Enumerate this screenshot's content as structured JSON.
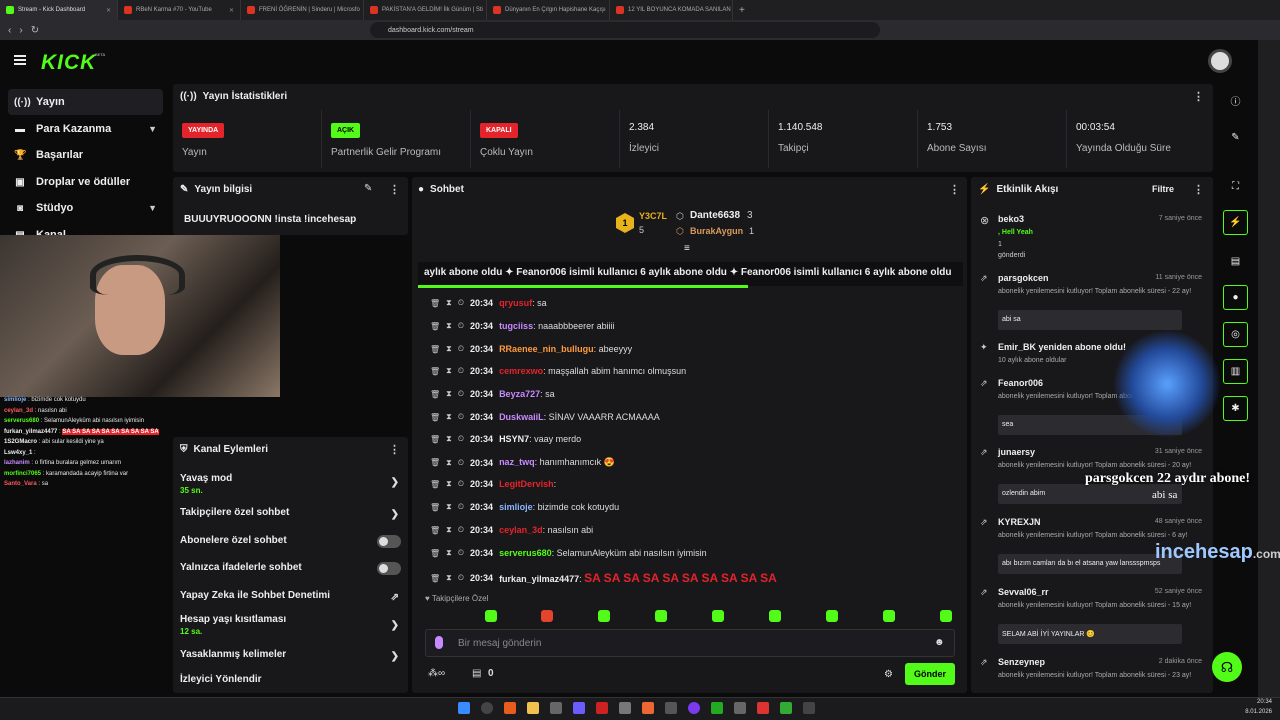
{
  "browser": {
    "tabs": [
      {
        "title": "Stream - Kick Dashboard",
        "active": true
      },
      {
        "title": "RBeN Karma #70 - YouTube"
      },
      {
        "title": "FRENİ ÖĞRENİN | Sinderu | Microsfo"
      },
      {
        "title": "PAKİSTAN'A GELDİM! İlk Günüm | Sti"
      },
      {
        "title": "Dünyanın En Çılgın Hapishane Kaçışı"
      },
      {
        "title": "12 YIL BOYUNCA KOMADA SANILAN"
      }
    ],
    "url": "dashboard.kick.com/stream"
  },
  "brand": {
    "logo": "KICK",
    "beta": "BETA"
  },
  "sidebar": {
    "items": [
      {
        "label": "Yayın",
        "icon": "broadcast-icon"
      },
      {
        "label": "Para Kazanma",
        "icon": "money-icon"
      },
      {
        "label": "Başarılar",
        "icon": "trophy-icon"
      },
      {
        "label": "Droplar ve ödüller",
        "icon": "gift-icon"
      },
      {
        "label": "Stüdyo",
        "icon": "studio-icon"
      },
      {
        "label": "Kanal",
        "icon": "channel-icon"
      }
    ]
  },
  "stats": {
    "title": "Yayın İstatistikleri",
    "items": [
      {
        "badge": "YAYINDA",
        "label": "Yayın",
        "color": "#e3242b"
      },
      {
        "badge": "AÇIK",
        "label": "Partnerlik Gelir Programı",
        "color": "#53fc18"
      },
      {
        "badge": "KAPALI",
        "label": "Çoklu Yayın",
        "color": "#e3242b"
      },
      {
        "value": "2.384",
        "label": "İzleyici"
      },
      {
        "value": "1.140.548",
        "label": "Takipçi"
      },
      {
        "value": "1.753",
        "label": "Abone Sayısı"
      },
      {
        "value": "00:03:54",
        "label": "Yayında Olduğu Süre"
      }
    ]
  },
  "info": {
    "title": "Yayın bilgisi",
    "stream_title": "BUUUYRUOOONN !insta !incehesap"
  },
  "overlay_chat": [
    {
      "user": "simlioje",
      "msg": "bizimde cok kotuydu",
      "color": "#8ab4ff"
    },
    {
      "user": "ceylan_3d",
      "msg": "nasılsn abi",
      "color": "#ff5a5a"
    },
    {
      "user": "serverus680",
      "msg": "SelamunAleyküm abi nasılsın iyimisin",
      "color": "#53fc18"
    },
    {
      "user": "furkan_yilmaz4477",
      "msg": "SA SA SA SA SA SA SA SA SA SA",
      "color": "#eee"
    },
    {
      "user": "1S2GMacro",
      "msg": "abi sular kesildi yine ya",
      "color": "#eee"
    },
    {
      "user": "Lsw4xy_1",
      "msg": "",
      "color": "#eee"
    },
    {
      "user": "lazhanim",
      "msg": "o firtina buralara gelmez umarım",
      "color": "#c78bff"
    },
    {
      "user": "morfinci7065",
      "msg": "karamandada acayip firtina var",
      "color": "#53fc18"
    },
    {
      "user": "Santo_Vara",
      "msg": "sa",
      "color": "#ff5a5a"
    }
  ],
  "actions": {
    "title": "Kanal Eylemleri",
    "items": [
      {
        "label": "Yavaş mod",
        "sub": "35 sn.",
        "type": "chevron"
      },
      {
        "label": "Takipçilere özel sohbet",
        "type": "chevron"
      },
      {
        "label": "Abonelere özel sohbet",
        "type": "toggle"
      },
      {
        "label": "Yalnızca ifadelerle sohbet",
        "type": "toggle"
      },
      {
        "label": "Yapay Zeka ile Sohbet Denetimi",
        "type": "external"
      },
      {
        "label": "Hesap yaşı kısıtlaması",
        "sub": "12 sa.",
        "type": "chevron"
      },
      {
        "label": "Yasaklanmış kelimeler",
        "type": "chevron"
      },
      {
        "label": "İzleyici Yönlendir",
        "type": "none"
      }
    ]
  },
  "chat": {
    "title": "Sohbet",
    "leaders": [
      {
        "rank": "1",
        "name": "Y3C7L",
        "count": "5"
      },
      {
        "name": "Dante6638",
        "count": "3"
      },
      {
        "name": "BurakAygun",
        "count": "1"
      }
    ],
    "ticker": "aylık abone oldu  ✦ Feanor006 isimli kullanıcı 6 aylık abone oldu  ✦ Feanor006 isimli kullanıcı 6 aylık abone oldu",
    "messages": [
      {
        "time": "20:34",
        "user": "qryusuf",
        "msg": "sa",
        "color": "#e3242b"
      },
      {
        "time": "20:34",
        "user": "tugciiss",
        "msg": "naaabbbeerer abiiii",
        "color": "#c78bff"
      },
      {
        "time": "20:34",
        "user": "RRaenee_nin_bullugu",
        "msg": "abeeyyy",
        "color": "#ff9a3c"
      },
      {
        "time": "20:34",
        "user": "cemrexwo",
        "msg": "maşşallah abim hanımcı olmuşsun",
        "color": "#e3242b"
      },
      {
        "time": "20:34",
        "user": "Beyza727",
        "msg": "sa",
        "color": "#c78bff"
      },
      {
        "time": "20:34",
        "user": "DuskwaiiL",
        "msg": "SİNAV VAAARR ACMAAAA",
        "color": "#c78bff"
      },
      {
        "time": "20:34",
        "user": "HSYN7",
        "msg": "vaay merdo",
        "color": "#eee"
      },
      {
        "time": "20:34",
        "user": "naz_twq",
        "msg": "hanımhanımcık 😍",
        "color": "#c78bff"
      },
      {
        "time": "20:34",
        "user": "LegitDervish",
        "msg": "",
        "color": "#e3242b"
      },
      {
        "time": "20:34",
        "user": "simlioje",
        "msg": "bizimde cok kotuydu",
        "color": "#8ab4ff"
      },
      {
        "time": "20:34",
        "user": "ceylan_3d",
        "msg": "nasılsın abi",
        "color": "#e3242b"
      },
      {
        "time": "20:34",
        "user": "serverus680",
        "msg": "SelamunAleyküm abi nasılsın iyimisin",
        "color": "#53fc18"
      },
      {
        "time": "20:34",
        "user": "furkan_yilmaz4477",
        "msg": "SA SA SA SA SA SA SA SA SA SA",
        "color": "#eee"
      }
    ],
    "mode": "Takipçilere Özel",
    "placeholder": "Bir mesaj gönderin",
    "points": "0",
    "send": "Gönder"
  },
  "activity": {
    "title": "Etkinlik Akışı",
    "filter": "Filtre",
    "items": [
      {
        "name": "beko3",
        "time": "7 saniye önce",
        "desc": ", Hell Yeah",
        "extra": "1",
        "extra2": "gönderdi"
      },
      {
        "name": "parsgokcen",
        "time": "11 saniye önce",
        "desc": "abonelik yenilemesini kutluyor! Toplam abonelik süresi - 22 ay!",
        "msg": "abi sa"
      },
      {
        "name": "Emir_BK yeniden abone oldu!",
        "time": "",
        "desc": "10 aylık abone oldular"
      },
      {
        "name": "Feanor006",
        "time": "",
        "desc": "abonelik yenilemesini kutluyor! Toplam abonelik süresi - 6 ay!",
        "msg": "sea"
      },
      {
        "name": "junaersy",
        "time": "31 saniye önce",
        "desc": "abonelik yenilemesini kutluyor! Toplam abonelik süresi - 20 ay!",
        "msg": "ozlendin abim"
      },
      {
        "name": "KYREXJN",
        "time": "48 saniye önce",
        "desc": "abonelik yenilemesini kutluyor! Toplam abonelik süresi - 6 ay!",
        "msg": "abı bızım camları da bı el atsana yaw lanssspmsps"
      },
      {
        "name": "Sevval06_rr",
        "time": "52 saniye önce",
        "desc": "abonelik yenilemesini kutluyor! Toplam abonelik süresi - 15 ay!",
        "msg": "SELAM ABİ İYİ YAYINLAR 😊"
      },
      {
        "name": "Senzeynep",
        "time": "2 dakika önce",
        "desc": "abonelik yenilemesini kutluyor! Toplam abonelik süresi - 23 ay!"
      }
    ]
  },
  "overlay": {
    "sub_alert": "parsgokcen 22 aydır abone!",
    "sub_msg": "abi sa",
    "sponsor": "incehesap",
    ".com": ".com"
  },
  "taskbar": {
    "time": "20:34",
    "date": "8.01.2026"
  }
}
